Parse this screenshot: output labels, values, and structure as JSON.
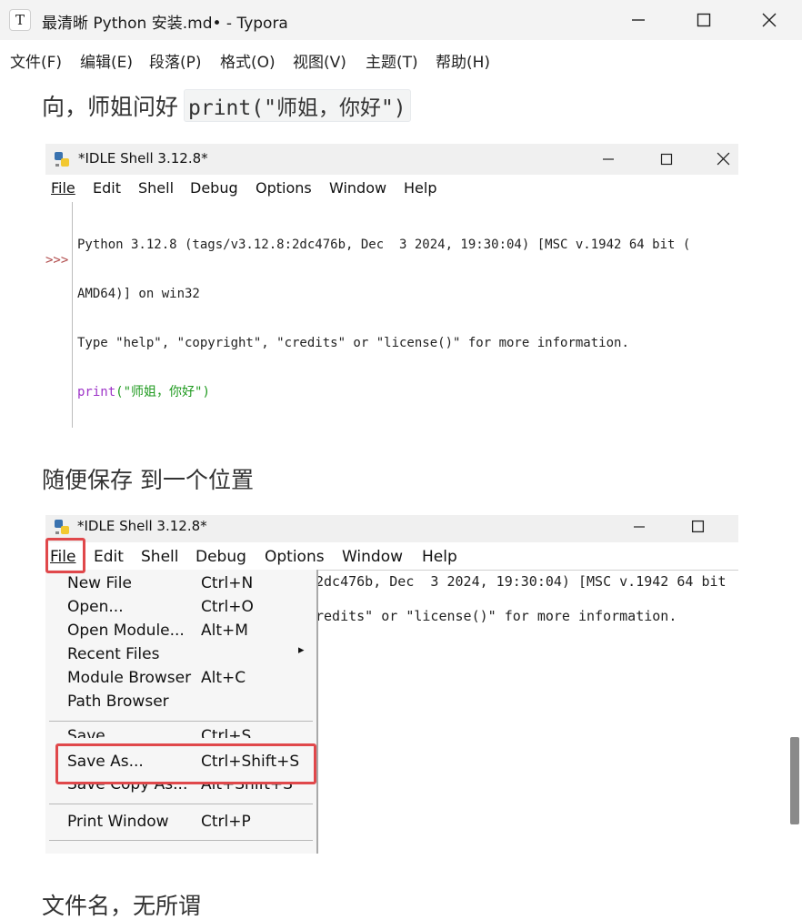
{
  "window": {
    "app_icon_letter": "T",
    "title": "最清晰 Python 安装.md• - Typora",
    "controls": [
      "minimize",
      "maximize",
      "close"
    ]
  },
  "menubar": {
    "items": [
      "文件(F)",
      "编辑(E)",
      "段落(P)",
      "格式(O)",
      "视图(V)",
      "主题(T)",
      "帮助(H)"
    ]
  },
  "content": {
    "heading1_text": "向，师姐问好",
    "heading1_code": "print(\"师姐，你好\")",
    "heading2": "随便保存 到一个位置",
    "heading3": "文件名，无所谓"
  },
  "idle1": {
    "title": "*IDLE Shell 3.12.8*",
    "menu": [
      "File",
      "Edit",
      "Shell",
      "Debug",
      "Options",
      "Window",
      "Help"
    ],
    "lines": [
      "Python 3.12.8 (tags/v3.12.8:2dc476b, Dec  3 2024, 19:30:04) [MSC v.1942 64 bit (",
      "AMD64)] on win32",
      "Type \"help\", \"copyright\", \"credits\" or \"license()\" for more information."
    ],
    "prompt": ">>>",
    "input_keyword": "print",
    "input_string": "(\"师姐，你好\")"
  },
  "idle2": {
    "title": "*IDLE Shell 3.12.8*",
    "menu": [
      "File",
      "Edit",
      "Shell",
      "Debug",
      "Options",
      "Window",
      "Help"
    ],
    "line1_partial": "2dc476b, Dec  3 2024, 19:30:04) [MSC v.1942 64 bit",
    "line3_partial": "redits\" or \"license()\" for more information.",
    "file_menu": [
      {
        "label": "New File",
        "accel": "Ctrl+N"
      },
      {
        "label": "Open...",
        "accel": "Ctrl+O"
      },
      {
        "label": "Open Module...",
        "accel": "Alt+M"
      },
      {
        "label": "Recent Files",
        "accel": "▸"
      },
      {
        "label": "Module Browser",
        "accel": "Alt+C"
      },
      {
        "label": "Path Browser",
        "accel": ""
      },
      {
        "label": "Save",
        "accel": "Ctrl+S"
      },
      {
        "label": "Save As...",
        "accel": "Ctrl+Shift+S"
      },
      {
        "label": "Save Copy As...",
        "accel": "Alt+Shift+S"
      },
      {
        "label": "Print Window",
        "accel": "Ctrl+P"
      }
    ],
    "highlight_color": "#e0484b"
  }
}
